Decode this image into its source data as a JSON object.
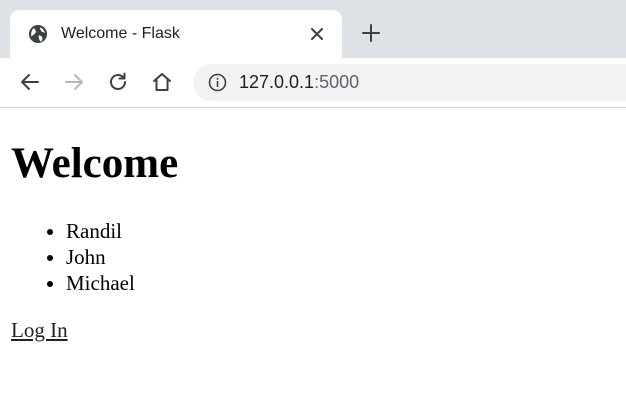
{
  "browser": {
    "tab": {
      "title": "Welcome - Flask",
      "favicon": "globe-icon",
      "close_icon": "close-icon"
    },
    "new_tab_icon": "plus-icon",
    "toolbar": {
      "back_icon": "back-arrow-icon",
      "forward_icon": "forward-arrow-icon",
      "reload_icon": "reload-icon",
      "home_icon": "home-icon",
      "site_info_icon": "info-icon",
      "url_host": "127.0.0.1",
      "url_port": ":5000"
    }
  },
  "page": {
    "title": "Welcome",
    "names": [
      "Randil",
      "John",
      "Michael"
    ],
    "login_link": "Log In"
  },
  "colors": {
    "tabstrip_bg": "#dee1e6",
    "omnibox_bg": "#f1f3f4",
    "text": "#202124",
    "muted_text": "#5f6368",
    "disabled_icon": "#b4b6b9"
  }
}
